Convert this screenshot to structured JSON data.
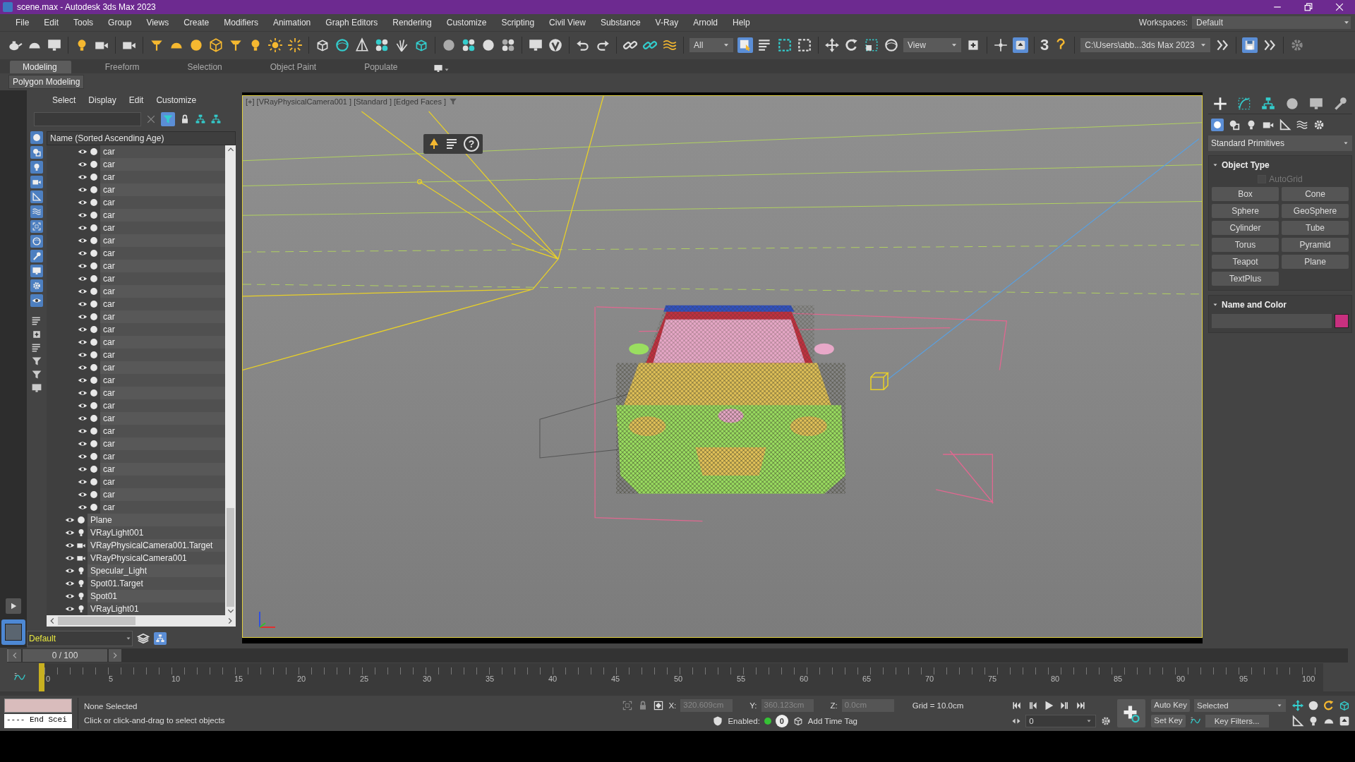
{
  "window": {
    "title": "scene.max - Autodesk 3ds Max 2023"
  },
  "menu": [
    "File",
    "Edit",
    "Tools",
    "Group",
    "Views",
    "Create",
    "Modifiers",
    "Animation",
    "Graph Editors",
    "Rendering",
    "Customize",
    "Scripting",
    "Civil View",
    "Substance",
    "V-Ray",
    "Arnold",
    "Help"
  ],
  "workspaces": {
    "label": "Workspaces:",
    "value": "Default"
  },
  "toolbar": {
    "selection_filter": "All",
    "reference_coord": "View",
    "snap_button": "3",
    "project_path": "C:\\Users\\abb...3ds Max 2023"
  },
  "ribbon": {
    "tabs": [
      {
        "label": "Modeling",
        "selected": true
      },
      {
        "label": "Freeform",
        "selected": false
      },
      {
        "label": "Selection",
        "selected": false
      },
      {
        "label": "Object Paint",
        "selected": false
      },
      {
        "label": "Populate",
        "selected": false
      }
    ],
    "panel": "Polygon Modeling"
  },
  "scene_explorer": {
    "menu": [
      "Select",
      "Display",
      "Edit",
      "Customize"
    ],
    "column": "Name (Sorted Ascending Age)",
    "nested_items": [
      {
        "name": "car",
        "kind": "geometry"
      },
      {
        "name": "car",
        "kind": "geometry"
      },
      {
        "name": "car",
        "kind": "geometry"
      },
      {
        "name": "car",
        "kind": "geometry"
      },
      {
        "name": "car",
        "kind": "geometry"
      },
      {
        "name": "car",
        "kind": "geometry"
      },
      {
        "name": "car",
        "kind": "geometry"
      },
      {
        "name": "car",
        "kind": "geometry"
      },
      {
        "name": "car",
        "kind": "geometry"
      },
      {
        "name": "car",
        "kind": "geometry"
      },
      {
        "name": "car",
        "kind": "geometry"
      },
      {
        "name": "car",
        "kind": "geometry"
      },
      {
        "name": "car",
        "kind": "geometry"
      },
      {
        "name": "car",
        "kind": "geometry"
      },
      {
        "name": "car",
        "kind": "geometry"
      },
      {
        "name": "car",
        "kind": "geometry"
      },
      {
        "name": "car",
        "kind": "geometry"
      },
      {
        "name": "car",
        "kind": "geometry"
      },
      {
        "name": "car",
        "kind": "geometry"
      },
      {
        "name": "car",
        "kind": "geometry"
      },
      {
        "name": "car",
        "kind": "geometry"
      },
      {
        "name": "car",
        "kind": "geometry"
      },
      {
        "name": "car",
        "kind": "geometry"
      },
      {
        "name": "car",
        "kind": "geometry"
      },
      {
        "name": "car",
        "kind": "geometry"
      },
      {
        "name": "car",
        "kind": "geometry"
      },
      {
        "name": "car",
        "kind": "geometry"
      },
      {
        "name": "car",
        "kind": "geometry"
      },
      {
        "name": "car",
        "kind": "geometry"
      }
    ],
    "items": [
      {
        "name": "Plane",
        "kind": "geometry"
      },
      {
        "name": "VRayLight001",
        "kind": "light"
      },
      {
        "name": "VRayPhysicalCamera001.Target",
        "kind": "camera"
      },
      {
        "name": "VRayPhysicalCamera001",
        "kind": "camera"
      },
      {
        "name": "Specular_Light",
        "kind": "light"
      },
      {
        "name": "Spot01.Target",
        "kind": "light"
      },
      {
        "name": "Spot01",
        "kind": "light"
      },
      {
        "name": "VRayLight01",
        "kind": "light"
      }
    ],
    "layer": "Default"
  },
  "viewport": {
    "label": "[+] [VRayPhysicalCamera001 ] [Standard ] [Edged Faces ]",
    "help_button": "?"
  },
  "command_panel": {
    "category": "Standard Primitives",
    "object_type": {
      "title": "Object Type",
      "autogrid": {
        "label": "AutoGrid",
        "checked": false,
        "disabled": true
      },
      "buttons": [
        "Box",
        "Cone",
        "Sphere",
        "GeoSphere",
        "Cylinder",
        "Tube",
        "Torus",
        "Pyramid",
        "Teapot",
        "Plane",
        "TextPlus"
      ]
    },
    "name_color": {
      "title": "Name and Color",
      "color": "#c8307f"
    }
  },
  "timeline": {
    "frame_slider": {
      "label": "0 / 100",
      "level": 0
    },
    "ticks": [
      "0",
      "5",
      "10",
      "15",
      "20",
      "25",
      "30",
      "35",
      "40",
      "45",
      "50",
      "55",
      "60",
      "65",
      "70",
      "75",
      "80",
      "85",
      "90",
      "95",
      "100"
    ]
  },
  "status_bar": {
    "maxscript": "---- End Scei",
    "selection": "None Selected",
    "prompt": "Click or click-and-drag to select objects",
    "x_label": "X:",
    "x": "320.609cm",
    "y_label": "Y:",
    "y": "360.123cm",
    "z_label": "Z:",
    "z": "0.0cm",
    "grid": "Grid = 10.0cm",
    "enabled_label": "Enabled:",
    "enabled": true,
    "adaptive": "0",
    "time_tag": "Add Time Tag",
    "frame": "0",
    "auto_key": "Auto Key",
    "set_key": "Set Key",
    "key_mode": "Selected",
    "key_filters": "Key Filters..."
  }
}
